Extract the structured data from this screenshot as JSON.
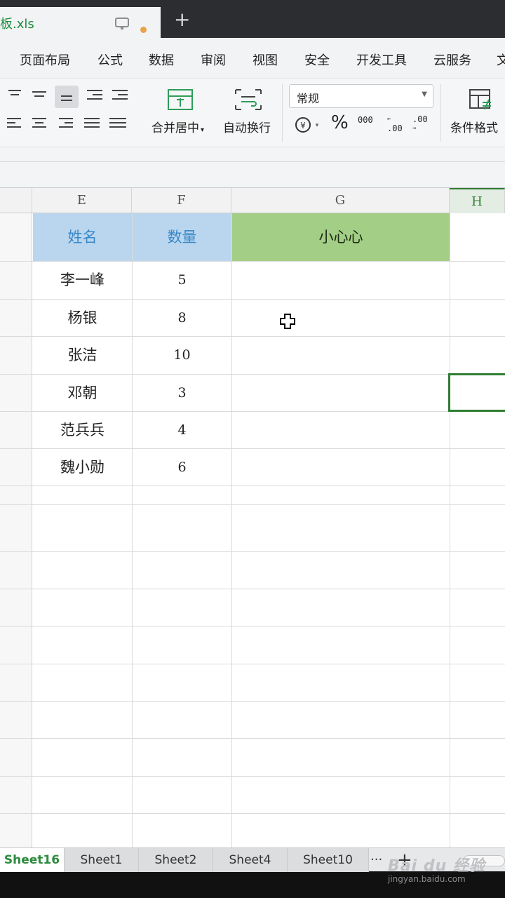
{
  "tab": {
    "title": "板.xls",
    "new_tab": "+"
  },
  "menu": {
    "items": [
      "页面布局",
      "公式",
      "数据",
      "审阅",
      "视图",
      "安全",
      "开发工具",
      "云服务",
      "文"
    ]
  },
  "ribbon": {
    "merge_center": "合并居中",
    "wrap_text": "自动换行",
    "number_format": "常规",
    "conditional_format": "条件格式",
    "percent": "%",
    "currency_symbol": "¥",
    "thousands": "000",
    "inc_decimal": ".00",
    "dec_decimal": ".00"
  },
  "columns": [
    "E",
    "F",
    "G",
    "H"
  ],
  "table": {
    "headers": [
      "姓名",
      "数量",
      "小心心"
    ],
    "rows": [
      {
        "name": "李一峰",
        "qty": "5"
      },
      {
        "name": "杨银",
        "qty": "8"
      },
      {
        "name": "张洁",
        "qty": "10"
      },
      {
        "name": "邓朝",
        "qty": "3"
      },
      {
        "name": "范兵兵",
        "qty": "4"
      },
      {
        "name": "魏小勋",
        "qty": "6"
      }
    ]
  },
  "sheets": [
    "Sheet16",
    "Sheet1",
    "Sheet2",
    "Sheet4",
    "Sheet10"
  ],
  "sheet_more": "···",
  "sheet_add": "+",
  "watermark": {
    "brand": "Bai du 经验",
    "url": "jingyan.baidu.com"
  }
}
